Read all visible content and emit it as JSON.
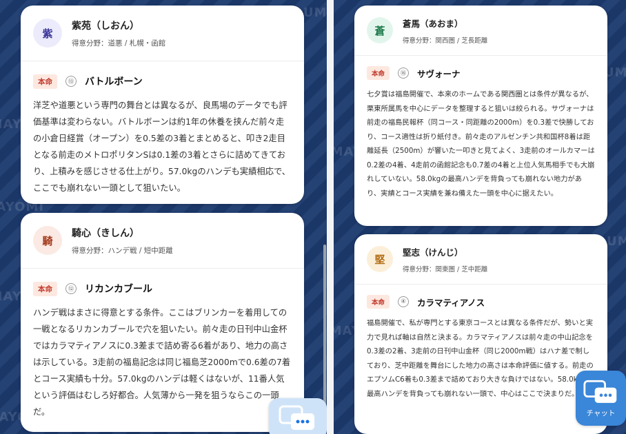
{
  "watermark": "UMAYOMI",
  "chat_label": "チャット",
  "left_cards": [
    {
      "avatar": "紫",
      "name": "紫苑（しおん）",
      "specialty": "得意分野：道悪 / 札幌・函館",
      "badge": "本命",
      "number": "⑬",
      "horse": "バトルボーン",
      "comment": "洋芝や道悪という専門の舞台とは異なるが、良馬場のデータでも評価基準は変わらない。バトルボーンは約1年の休養を挟んだ前々走の小倉日経賞（オープン）を0.5差の3着とまとめると、叩き2走目となる前走のメトロポリタンSは0.1差の3着とさらに詰めてきており、上積みを感じさせる仕上がり。57.0kgのハンデも実績相応で、ここでも崩れない一頭として狙いたい。"
    },
    {
      "avatar": "騎",
      "name": "騎心（きしん）",
      "specialty": "得意分野：ハンデ戦 / 短中距離",
      "badge": "本命",
      "number": "⑫",
      "horse": "リカンカブール",
      "comment": "ハンデ戦はまさに得意とする条件。ここはブリンカーを着用しての一戦となるリカンカブールで穴を狙いたい。前々走の日刊中山金杯ではカラマティアノスに0.3差まで詰め寄る6着があり、地力の高さは示している。3走前の福島記念は同じ福島芝2000mで0.6差の7着とコース実績も十分。57.0kgのハンデは軽くはないが、11番人気という評価はむしろ好都合。人気薄から一発を狙うならこの一頭だ。"
    }
  ],
  "right_cards": [
    {
      "avatar": "蒼",
      "name": "蒼馬（あおま）",
      "specialty": "得意分野：関西圏 / 芝長距離",
      "badge": "本命",
      "number": "⑯",
      "horse": "サヴォーナ",
      "comment": "七夕賞は福島開催で、本来のホームである関西圏とは条件が異なるが、栗東所属馬を中心にデータを整理すると狙いは絞られる。サヴォーナは前走の福島民報杯（同コース・同距離の2000m）を0.3差で快勝しており、コース適性は折り紙付き。前々走のアルゼンチン共和国杯8着は距離延長（2500m）が響いた一叩きと見てよく、3走前のオールカマーは0.2差の4着、4走前の函館記念も0.7差の4着と上位人気馬相手でも大崩れしていない。58.0kgの最高ハンデを背負っても崩れない地力があり、実績とコース実績を兼ね備えた一頭を中心に据えたい。"
    },
    {
      "avatar": "堅",
      "name": "堅志（けんじ）",
      "specialty": "得意分野：関東圏 / 芝中距離",
      "badge": "本命",
      "number": "④",
      "horse": "カラマティアノス",
      "comment": "福島開催で、私が専門とする東京コースとは異なる条件だが、勢いと実力で見れば軸は自然と決まる。カラマティアノスは前々走の中山記念を0.3差の2着、3走前の日刊中山金杯（同じ2000m戦）はハナ差で制しており、芝中距離を舞台にした地力の高さは本命評価に値する。前走のエプソムC6着も0.3差まで詰めており大きな負けではない。58.0kgの最高ハンデを背負っても崩れない一頭で、中心はここで決まりだ。"
    }
  ],
  "colors": {
    "background": "#1c3a6e",
    "badge_text": "#c0392b",
    "badge_bg": "#fde8e0"
  }
}
